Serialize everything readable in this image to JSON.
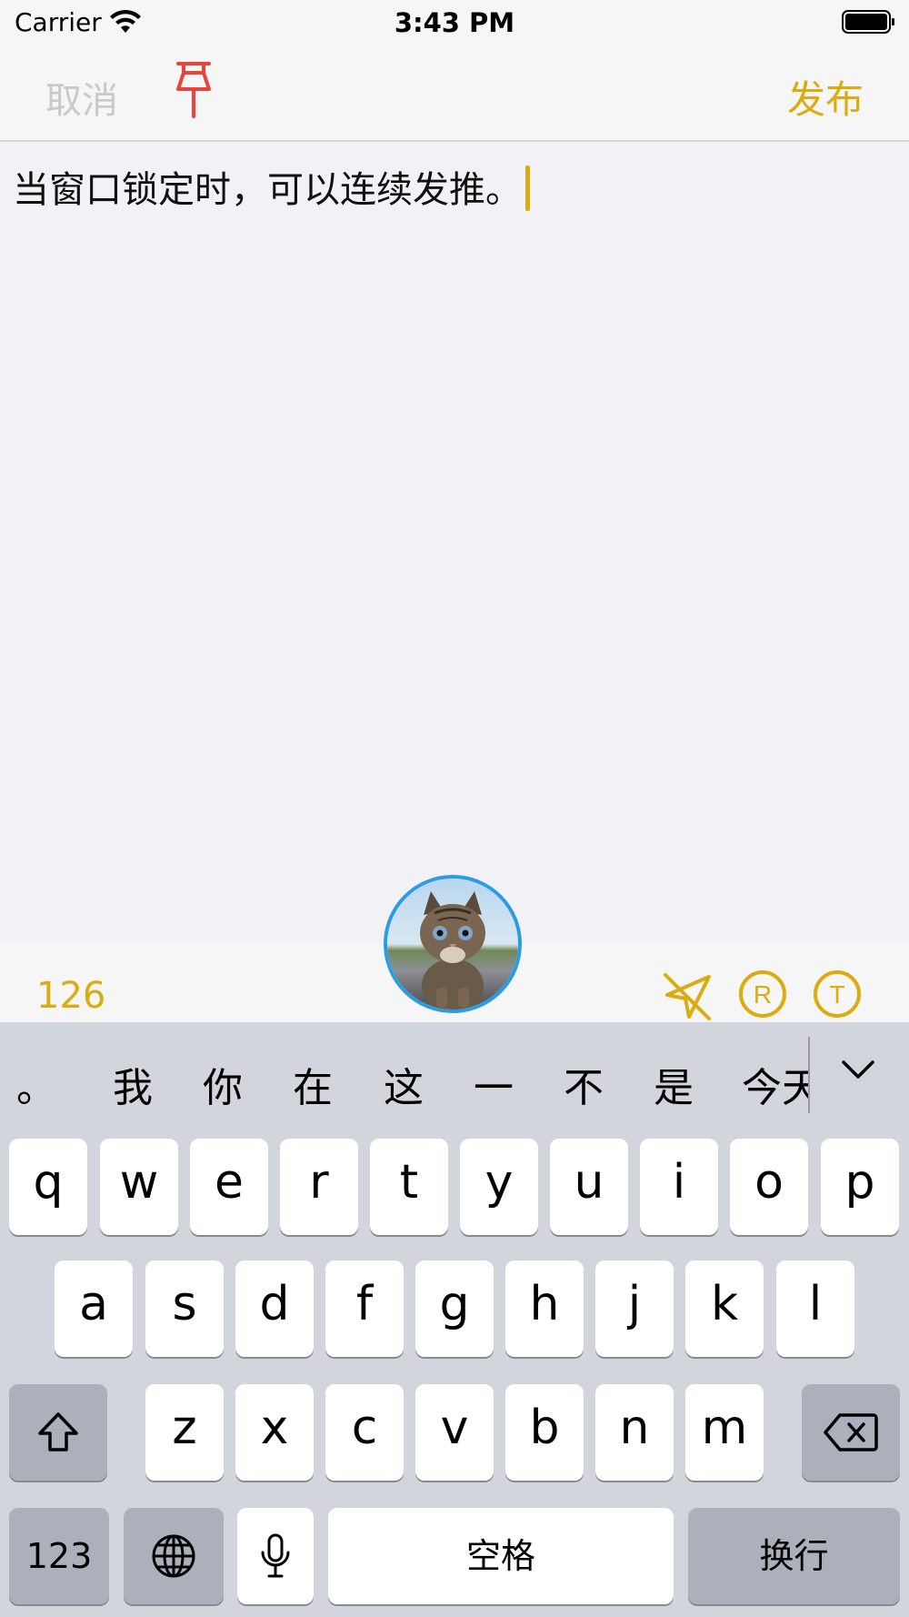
{
  "status_bar": {
    "carrier": "Carrier",
    "time": "3:43 PM"
  },
  "nav": {
    "cancel_label": "取消",
    "publish_label": "发布"
  },
  "compose": {
    "text": "当窗口锁定时，可以连续发推。"
  },
  "accessory": {
    "char_count": "126"
  },
  "colors": {
    "accent": "#d9ad12",
    "pin": "#e8443a",
    "avatar_ring": "#2b9be6"
  },
  "keyboard": {
    "candidates": [
      "。",
      "我",
      "你",
      "在",
      "这",
      "一",
      "不",
      "是",
      "今天"
    ],
    "row1": [
      "q",
      "w",
      "e",
      "r",
      "t",
      "y",
      "u",
      "i",
      "o",
      "p"
    ],
    "row2": [
      "a",
      "s",
      "d",
      "f",
      "g",
      "h",
      "j",
      "k",
      "l"
    ],
    "row3": [
      "z",
      "x",
      "c",
      "v",
      "b",
      "n",
      "m"
    ],
    "numbers_label": "123",
    "space_label": "空格",
    "return_label": "换行"
  }
}
